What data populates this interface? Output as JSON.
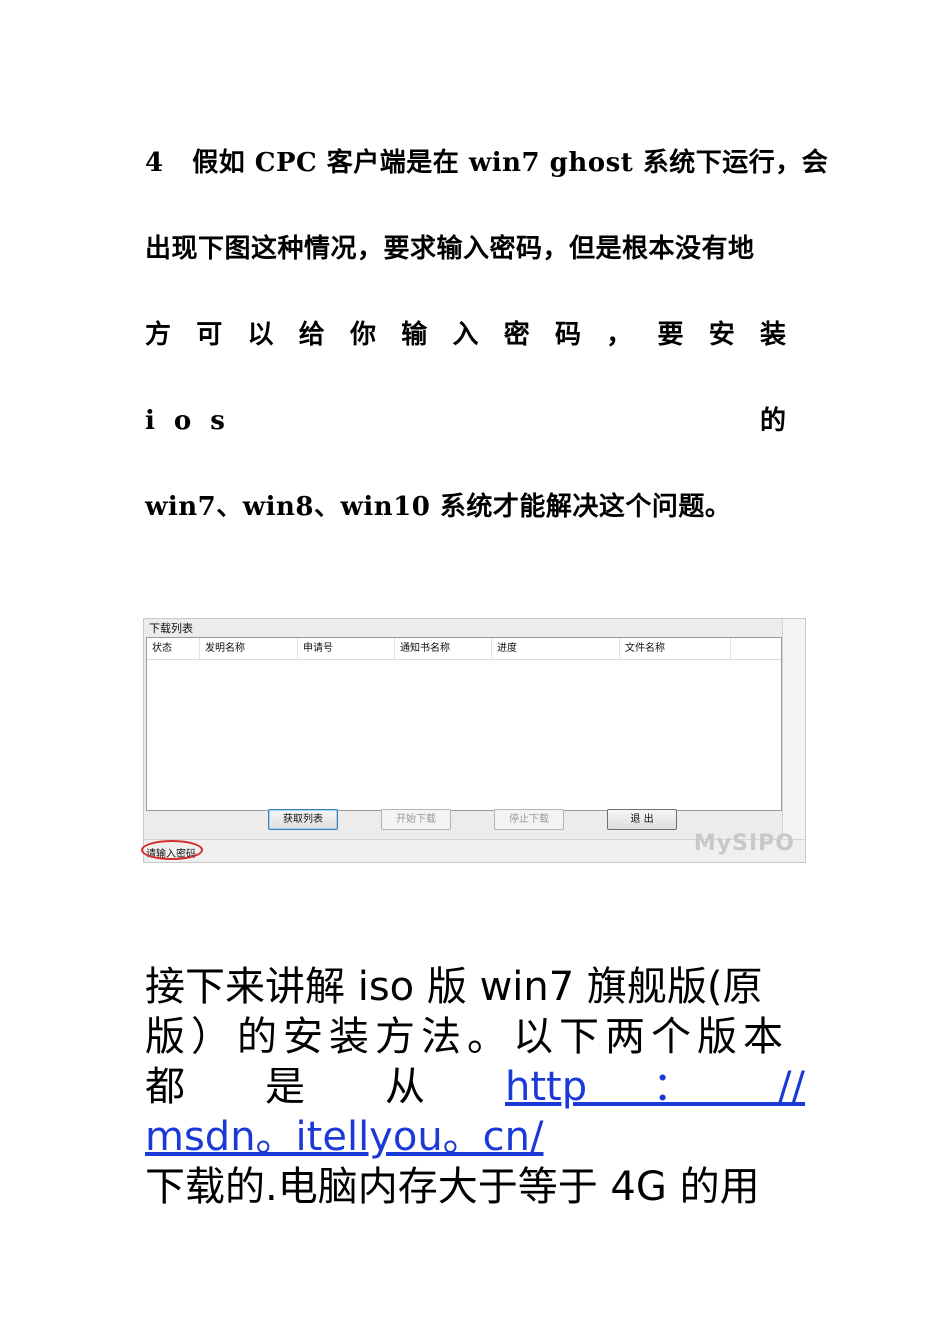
{
  "paragraph1": {
    "line1": "4   假如 CPC 客户端是在 win7 ghost 系统下运行，会",
    "line2": "出现下图这种情况，要求输入密码，但是根本没有地",
    "line3": "方可以给你输入密码，要安装 ios 的",
    "line4": "win7、win8、win10 系统才能解决这个问题。"
  },
  "dialog": {
    "group_label": "下载列表",
    "columns": [
      "状态",
      "发明名称",
      "申请号",
      "通知书名称",
      "进度",
      "文件名称"
    ],
    "buttons": {
      "fetch": "获取列表",
      "start": "开始下载",
      "stop": "停止下载",
      "exit": "退 出"
    },
    "status_text": "请输入密码",
    "watermark": "MySIPO"
  },
  "paragraph2": {
    "line1": "接下来讲解 iso 版 win7 旗舰版(原",
    "line2": "版）的安装方法。以下两个版本",
    "line3_words": [
      "都",
      "是",
      "从"
    ],
    "link_part1": "http  ：  //",
    "link_part2": "msdn。itellyou。cn/",
    "line5": "下载的.电脑内存大于等于 4G 的用"
  }
}
